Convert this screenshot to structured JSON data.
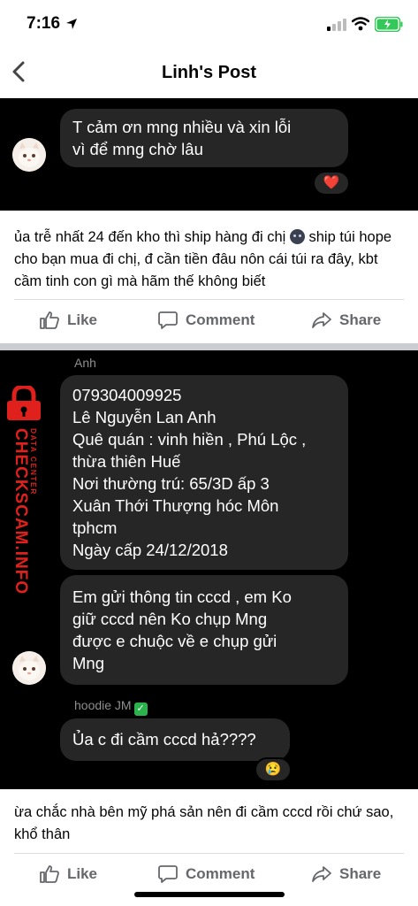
{
  "status_bar": {
    "time": "7:16"
  },
  "header": {
    "title": "Linh's Post"
  },
  "post1": {
    "messages": [
      {
        "text": "T cảm ơn mng nhiều và xin lỗi\nvì để mng chờ lâu"
      }
    ],
    "reaction": "❤️",
    "text_before": "ủa trễ nhất 24 đến kho thì ship hàng đi chị ",
    "text_after": " ship túi hope cho bạn mua đi chị, đ cần tiền đâu nôn cái túi ra đây, kbt cầm tinh con gì mà hãm thế không biết"
  },
  "post2": {
    "sender1": "Anh",
    "messages": [
      {
        "text": "079304009925\nLê Nguyễn Lan Anh\nQuê quán : vinh hiền , Phú Lộc ,\nthừa thiên Huế\nNơi thường trú: 65/3D ấp 3\nXuân Thới Thượng hóc Môn\ntphcm\nNgày cấp 24/12/2018"
      },
      {
        "text": "Em gửi thông tin cccd , em Ko\ngiữ cccd nên Ko chụp Mng\nđược e chuộc về e chụp gửi\nMng"
      }
    ],
    "sender2": "hoodie JM",
    "reply": "Ủa c đi cầm cccd hả????",
    "reaction": "😢",
    "text": "ừa chắc nhà bên mỹ phá sản nên đi cầm cccd rồi chứ sao, khổ thân"
  },
  "watermark": {
    "brand": "CHECKSCAM.INFO",
    "sub": "DATA CENTER"
  },
  "actions": {
    "like": "Like",
    "comment": "Comment",
    "share": "Share"
  },
  "colors": {
    "action_grey": "#65676b",
    "bubble": "#262626",
    "brand_red": "#e0201c"
  }
}
